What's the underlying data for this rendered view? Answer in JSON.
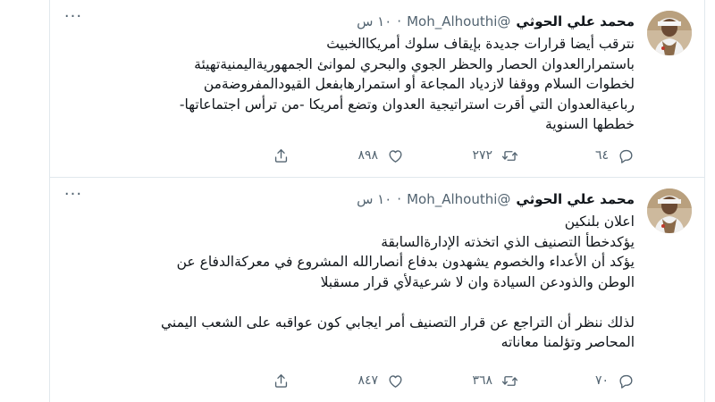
{
  "tweets": [
    {
      "author_name": "محمد علي الحوثي",
      "handle": "@Moh_Alhouthi",
      "dot": "·",
      "time": "١٠ س",
      "more_label": "···",
      "body_lines": [
        "نترقب أيضا قرارات جديدة بإيقاف سلوك أمريكاالخبيث",
        "باستمرارالعدوان الحصار والحظر الجوي والبحري لموانئ الجمهوريةاليمنيةتهيئة",
        "لخطوات السلام ووقفا لازدياد المجاعة أو استمرارهابفعل القيودالمفروضةمن",
        "رباعيةالعدوان التي أقرت استراتيجية العدوان وتضع أمريكا -من ترأس اجتماعاتها-",
        "خططها السنوية"
      ],
      "replies": "٦٤",
      "retweets": "٢٧٢",
      "likes": "٨٩٨"
    },
    {
      "author_name": "محمد علي الحوثي",
      "handle": "@Moh_Alhouthi",
      "dot": "·",
      "time": "١٠ س",
      "more_label": "···",
      "body_lines": [
        "اعلان بلنكين",
        "يؤكدخطأ التصنيف الذي اتخذته الإدارةالسابقة",
        "يؤكد أن الأعداء والخصوم يشهدون بدفاع أنصارالله المشروع في معركةالدفاع عن",
        "الوطن والذودعن السيادة وان لا شرعيةلأي قرار مسقبلا",
        "",
        "لذلك ننظر أن التراجع عن قرار التصنيف أمر ايجابي كون عواقبه على الشعب اليمني",
        "المحاصر وتؤلمنا معاناته"
      ],
      "replies": "٧٠",
      "retweets": "٣٦٨",
      "likes": "٨٤٧"
    }
  ]
}
